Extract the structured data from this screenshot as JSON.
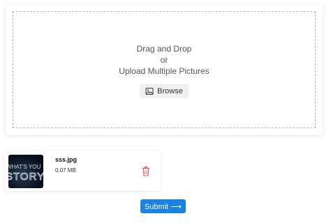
{
  "dropzone": {
    "line1": "Drag and Drop",
    "line2": "or",
    "line3": "Upload Multiple Pictures",
    "browse_label": "Browse"
  },
  "files": [
    {
      "name": "sss.jpg",
      "size": "0.07 MB",
      "thumbnail_text": "WHAT'S YOU STORY"
    }
  ],
  "submit_label": "Submit ⟶",
  "colors": {
    "accent": "#1a82e2",
    "delete": "#e05454",
    "browse_bg": "#f0f0f0"
  },
  "icons": {
    "browse": "image-icon",
    "delete": "trash-icon"
  }
}
